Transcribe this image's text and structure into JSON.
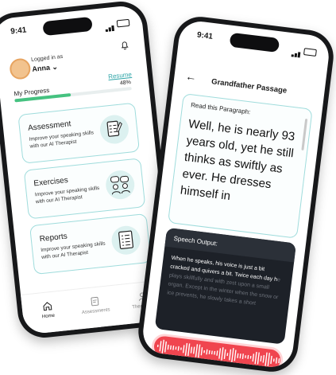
{
  "left_phone": {
    "time": "9:41",
    "user": {
      "logged_in_label": "Logged in as",
      "name": "Anna"
    },
    "progress": {
      "label": "My Progress",
      "resume_label": "Resume",
      "percent_label": "48%",
      "value": 0.48
    },
    "cards": [
      {
        "title": "Assessment",
        "desc": "Improve your speaking skills with our AI Therapist",
        "icon": "checklist-pen-icon"
      },
      {
        "title": "Exercises",
        "desc": "Improve your speaking skills with our AI Therapist",
        "icon": "people-chat-icon"
      },
      {
        "title": "Reports",
        "desc": "Improve your speaking skills with our AI Therapist",
        "icon": "report-list-icon"
      }
    ],
    "nav": {
      "home": "Home",
      "assessments": "Assessments",
      "therapists": "Therapists"
    }
  },
  "right_phone": {
    "time": "9:41",
    "title": "Grandfather Passage",
    "read_heading": "Read this Paragraph:",
    "paragraph": "Well, he is nearly 93 years old, yet he still thinks as swiftly as ever. He dresses himself in",
    "speech_heading": "Speech Output:",
    "speech_text": "When he speaks, his voice is just a bit cracked and quivers a bit. Twice each day h",
    "speech_faded": "e plays skillfully and with zest upon a small organ. Except in the winter when the snow or ice prevents, he slowly takes a short"
  },
  "colors": {
    "accent": "#2fa5a8",
    "progress": "#45c280",
    "record": "#f0454f",
    "dark_panel": "#1d2128"
  }
}
